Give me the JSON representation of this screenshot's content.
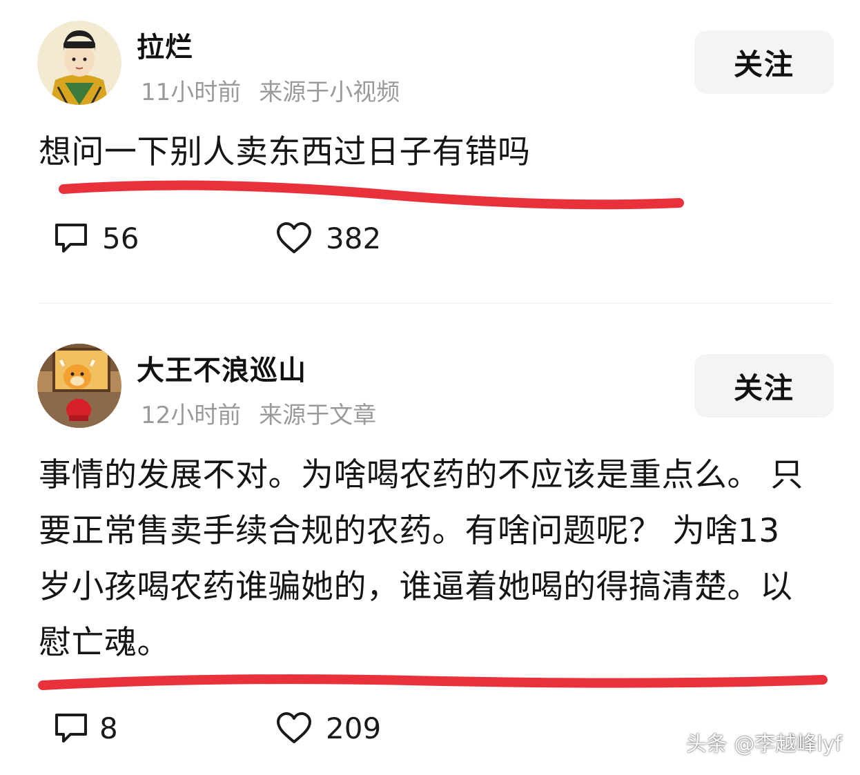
{
  "posts": [
    {
      "username": "拉烂",
      "time": "11小时前",
      "source": "来源于小视频",
      "follow_label": "关注",
      "content": "想问一下别人卖东西过日子有错吗",
      "comments": "56",
      "likes": "382",
      "avatar": "cartoon-boy-avatar"
    },
    {
      "username": "大王不浪巡山",
      "time": "12小时前",
      "source": "来源于文章",
      "follow_label": "关注",
      "content": "事情的发展不对。为啥喝农药的不应该是重点么。 只要正常售卖手续合规的农药。有啥问题呢？ 为啥13岁小孩喝农药谁骗她的，谁逼着她喝的得搞清楚。以慰亡魂。",
      "comments": "8",
      "likes": "209",
      "avatar": "ox-figurine-avatar"
    }
  ],
  "watermark": "头条 @李越峰lyf",
  "colors": {
    "underline": "#e8313a",
    "meta": "#9a9a9a",
    "follow_bg": "#f4f4f4"
  },
  "icons": [
    "comment-icon",
    "heart-icon"
  ]
}
